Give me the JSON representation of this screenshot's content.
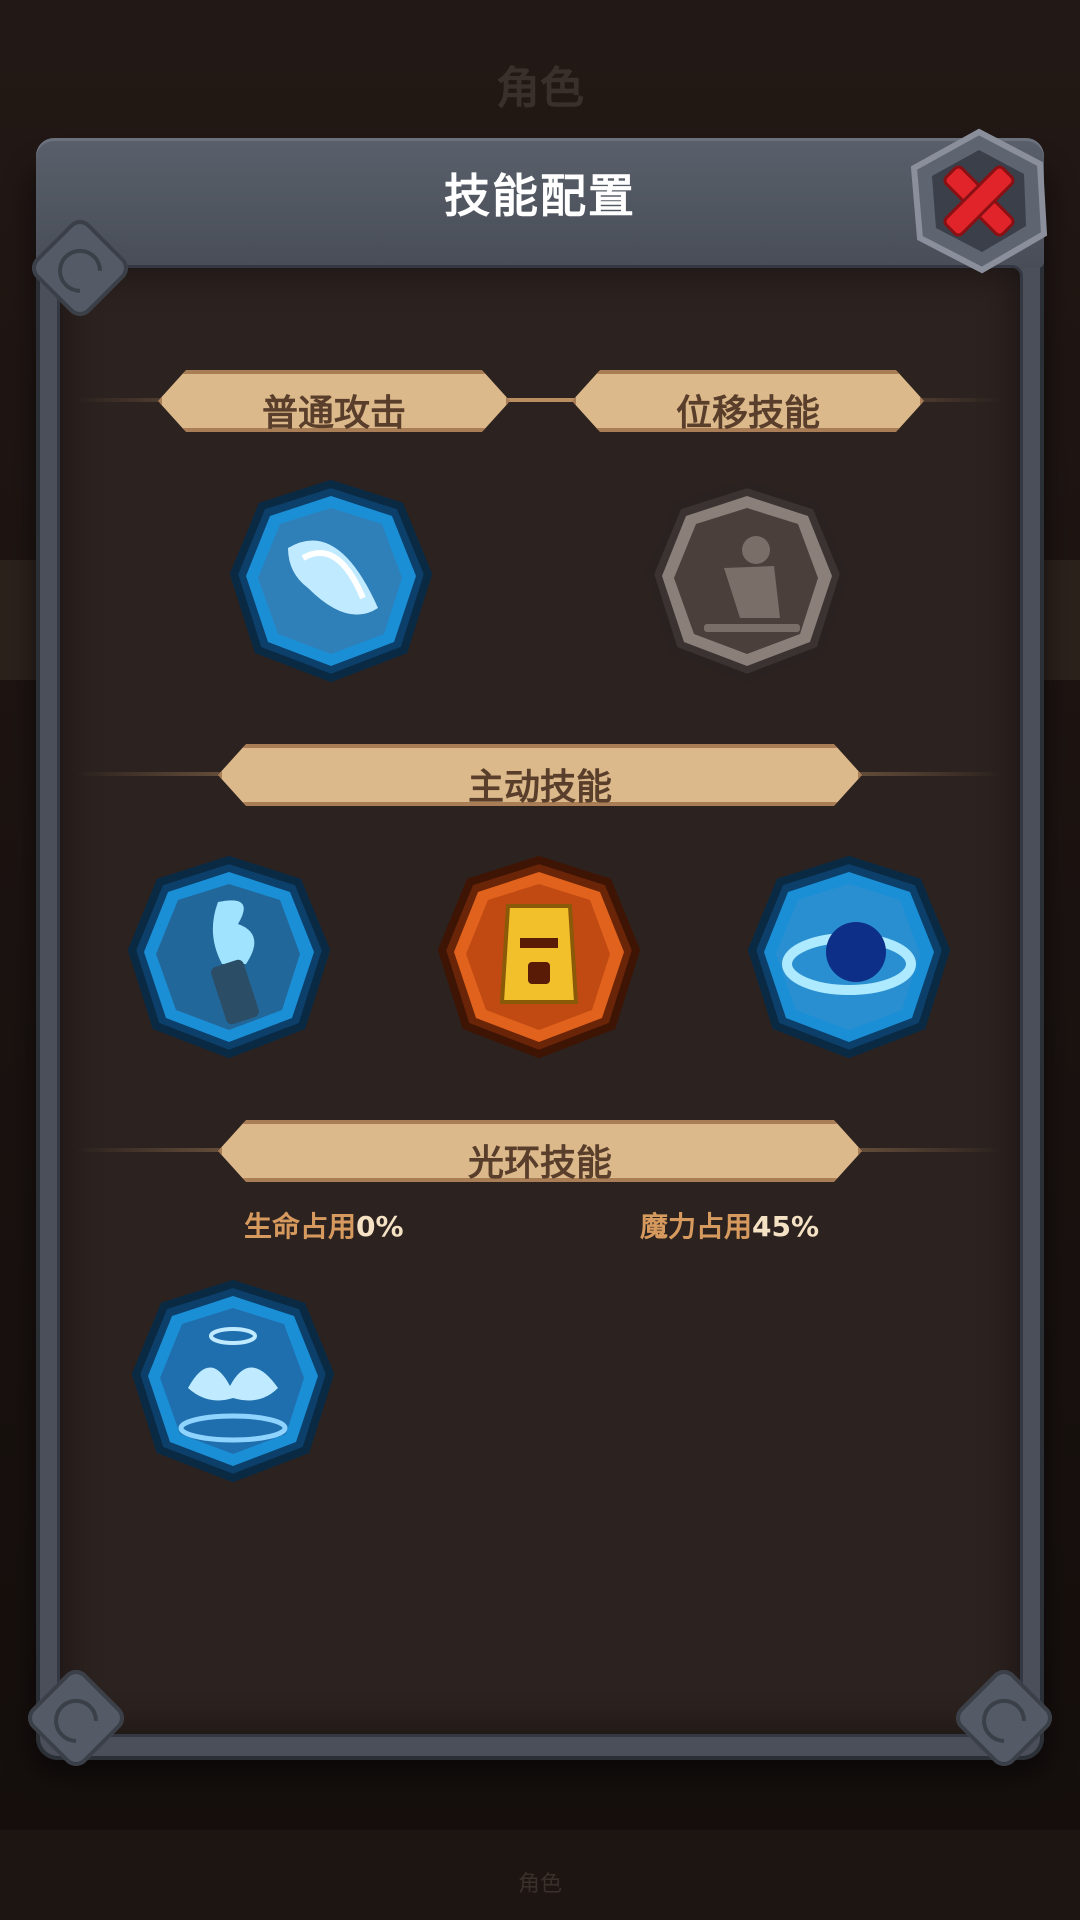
{
  "background": {
    "title": "角色",
    "subtitle": "",
    "tab_label": "角色"
  },
  "dialog": {
    "title": "技能配置",
    "close_icon": "red-x-close-icon"
  },
  "sections": {
    "basic_attack": {
      "label": "普通攻击"
    },
    "movement_skill": {
      "label": "位移技能"
    },
    "active_skills": {
      "label": "主动技能"
    },
    "aura_skills": {
      "label": "光环技能"
    }
  },
  "skills": {
    "basic": [
      {
        "icon": "ice-bolt-icon",
        "color": "#1b8fd6",
        "state": "equipped"
      }
    ],
    "movement": [
      {
        "icon": "dash-silhouette-icon",
        "color": "#7a6e68",
        "state": "locked"
      }
    ],
    "active": [
      {
        "icon": "frost-torch-icon",
        "color": "#1b8fd6"
      },
      {
        "icon": "golden-guardian-icon",
        "color": "#e0621c"
      },
      {
        "icon": "vortex-orb-icon",
        "color": "#1b8fd6"
      }
    ],
    "aura": [
      {
        "icon": "spirit-aura-icon",
        "color": "#1b8fd6"
      }
    ]
  },
  "aura_stats": {
    "hp_label": "生命占用",
    "hp_value": "0%",
    "mp_label": "魔力占用",
    "mp_value": "45%"
  },
  "colors": {
    "panel": "#2c221f",
    "frame": "#4a4f5a",
    "banner": "#dcb98a",
    "banner_text": "#5a3e2c",
    "stat_label": "#d79a5e"
  }
}
